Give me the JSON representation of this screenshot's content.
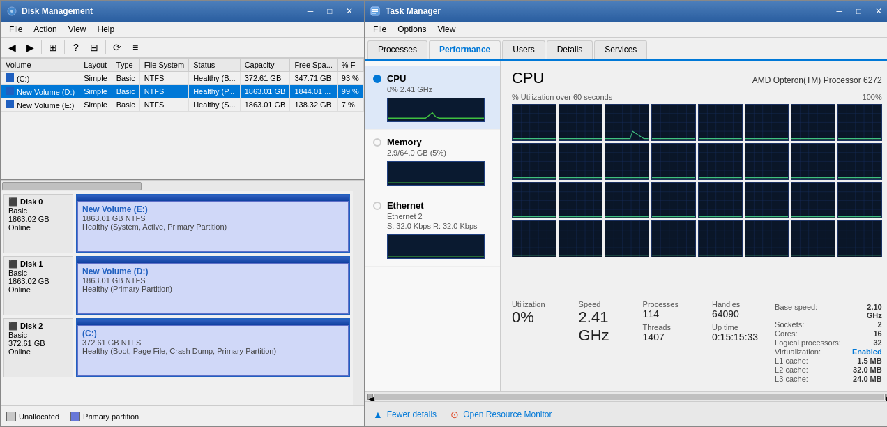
{
  "diskMgmt": {
    "title": "Disk Management",
    "menu": [
      "File",
      "Action",
      "View",
      "Help"
    ],
    "table": {
      "headers": [
        "Volume",
        "Layout",
        "Type",
        "File System",
        "Status",
        "Capacity",
        "Free Spa...",
        "% F"
      ],
      "rows": [
        {
          "volume": "(C:)",
          "layout": "Simple",
          "type": "Basic",
          "fs": "NTFS",
          "status": "Healthy (B...",
          "capacity": "372.61 GB",
          "free": "347.71 GB",
          "pct": "93 %"
        },
        {
          "volume": "New Volume (D:)",
          "layout": "Simple",
          "type": "Basic",
          "fs": "NTFS",
          "status": "Healthy (P...",
          "capacity": "1863.01 GB",
          "free": "1844.01 ...",
          "pct": "99 %"
        },
        {
          "volume": "New Volume (E:)",
          "layout": "Simple",
          "type": "Basic",
          "fs": "NTFS",
          "status": "Healthy (S...",
          "capacity": "1863.01 GB",
          "free": "138.32 GB",
          "pct": "7 %"
        }
      ]
    },
    "disks": [
      {
        "label": "Disk 0",
        "sublabel": "Basic",
        "size": "1863.02 GB",
        "status": "Online",
        "partitions": [
          {
            "name": "New Volume (E:)",
            "size": "1863.01 GB NTFS",
            "status": "Healthy (System, Active, Primary Partition)",
            "widthPct": 100
          }
        ]
      },
      {
        "label": "Disk 1",
        "sublabel": "Basic",
        "size": "1863.02 GB",
        "status": "Online",
        "partitions": [
          {
            "name": "New Volume (D:)",
            "size": "1863.01 GB NTFS",
            "status": "Healthy (Primary Partition)",
            "widthPct": 100
          }
        ]
      },
      {
        "label": "Disk 2",
        "sublabel": "Basic",
        "size": "372.61 GB",
        "status": "Online",
        "partitions": [
          {
            "name": "(C:)",
            "size": "372.61 GB NTFS",
            "status": "Healthy (Boot, Page File, Crash Dump, Primary Partition)",
            "widthPct": 80
          }
        ]
      }
    ],
    "legend": {
      "unallocated": "Unallocated",
      "primary": "Primary partition"
    }
  },
  "taskMgr": {
    "title": "Task Manager",
    "menu": [
      "File",
      "Options",
      "View"
    ],
    "tabs": [
      "Processes",
      "Performance",
      "Users",
      "Details",
      "Services"
    ],
    "activeTab": "Performance",
    "resources": [
      {
        "name": "CPU",
        "sub": "0%  2.41 GHz",
        "active": true
      },
      {
        "name": "Memory",
        "sub": "2.9/64.0 GB (5%)",
        "active": false
      },
      {
        "name": "Ethernet",
        "sub": "Ethernet 2",
        "sub2": "S: 32.0 Kbps  R: 32.0 Kbps",
        "active": false
      }
    ],
    "cpu": {
      "title": "CPU",
      "model": "AMD Opteron(TM) Processor 6272",
      "graphLabel": "% Utilization over 60 seconds",
      "graphMax": "100%",
      "stats": {
        "utilization": {
          "label": "Utilization",
          "value": "0%"
        },
        "speed": {
          "label": "Speed",
          "value": "2.41 GHz"
        },
        "processes": {
          "label": "Processes",
          "value": "114"
        },
        "threads": {
          "label": "Threads",
          "value": "1407"
        },
        "handles": {
          "label": "Handles",
          "value": "64090"
        },
        "uptime": {
          "label": "Up time",
          "value": "0:15:15:33"
        }
      },
      "info": {
        "baseSpeed": {
          "key": "Base speed:",
          "val": "2.10 GHz"
        },
        "sockets": {
          "key": "Sockets:",
          "val": "2"
        },
        "cores": {
          "key": "Cores:",
          "val": "16"
        },
        "logicalProc": {
          "key": "Logical processors:",
          "val": "32"
        },
        "virtualization": {
          "key": "Virtualization:",
          "val": "Enabled"
        },
        "l1cache": {
          "key": "L1 cache:",
          "val": "1.5 MB"
        },
        "l2cache": {
          "key": "L2 cache:",
          "val": "32.0 MB"
        },
        "l3cache": {
          "key": "L3 cache:",
          "val": "24.0 MB"
        }
      }
    },
    "footer": {
      "fewerDetails": "Fewer details",
      "openResourceMonitor": "Open Resource Monitor"
    }
  }
}
